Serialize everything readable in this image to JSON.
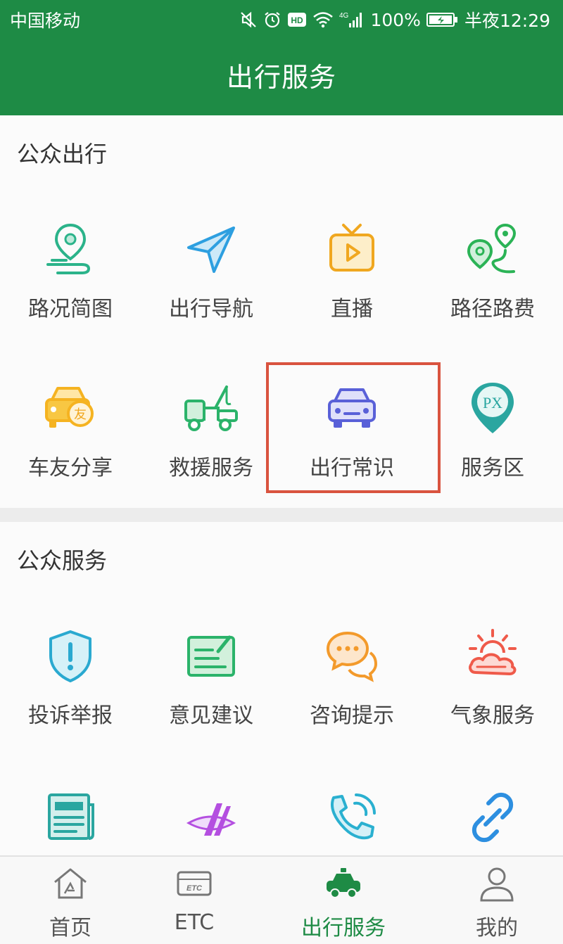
{
  "status_bar": {
    "carrier": "中国移动",
    "network": "4G",
    "battery": "100%",
    "time": "半夜12:29",
    "icons": [
      "mute-icon",
      "alarm-icon",
      "hd-icon",
      "wifi-icon",
      "signal-icon",
      "battery-icon"
    ]
  },
  "header": {
    "title": "出行服务"
  },
  "section1": {
    "title": "公众出行",
    "items": [
      {
        "label": "路况简图",
        "icon": "map-pin-route-icon",
        "color": "#2bb38a"
      },
      {
        "label": "出行导航",
        "icon": "navigation-arrow-icon",
        "color": "#2d9fe0"
      },
      {
        "label": "直播",
        "icon": "tv-play-icon",
        "color": "#f0a71f"
      },
      {
        "label": "路径路费",
        "icon": "route-pins-icon",
        "color": "#2bb356"
      },
      {
        "label": "车友分享",
        "icon": "car-friend-icon",
        "color": "#f5b321"
      },
      {
        "label": "救援服务",
        "icon": "tow-truck-icon",
        "color": "#2bb36a"
      },
      {
        "label": "出行常识",
        "icon": "car-front-icon",
        "color": "#5960d8"
      },
      {
        "label": "服务区",
        "icon": "service-area-pin-icon",
        "color": "#2aa6a0"
      }
    ]
  },
  "section2": {
    "title": "公众服务",
    "items": [
      {
        "label": "投诉举报",
        "icon": "shield-alert-icon",
        "color": "#2aa9d0"
      },
      {
        "label": "意见建议",
        "icon": "feedback-edit-icon",
        "color": "#2bb36a"
      },
      {
        "label": "咨询提示",
        "icon": "chat-bubbles-icon",
        "color": "#f39a2b"
      },
      {
        "label": "气象服务",
        "icon": "weather-sun-cloud-icon",
        "color": "#ef5a4a"
      },
      {
        "label": "",
        "icon": "newspaper-icon",
        "color": "#2aa6a0"
      },
      {
        "label": "",
        "icon": "highway-icon",
        "color": "#b44fe0"
      },
      {
        "label": "",
        "icon": "phone-call-icon",
        "color": "#2ab0d0"
      },
      {
        "label": "",
        "icon": "link-icon",
        "color": "#2d8fe0"
      }
    ]
  },
  "bottom_nav": {
    "items": [
      {
        "label": "首页",
        "icon": "home-icon"
      },
      {
        "label": "ETC",
        "icon": "etc-card-icon",
        "icon_text": "ETC"
      },
      {
        "label": "出行服务",
        "icon": "car-icon",
        "active": true
      },
      {
        "label": "我的",
        "icon": "user-icon"
      }
    ]
  },
  "colors": {
    "primary": "#1e8b45",
    "highlight_border": "#d9533f"
  }
}
